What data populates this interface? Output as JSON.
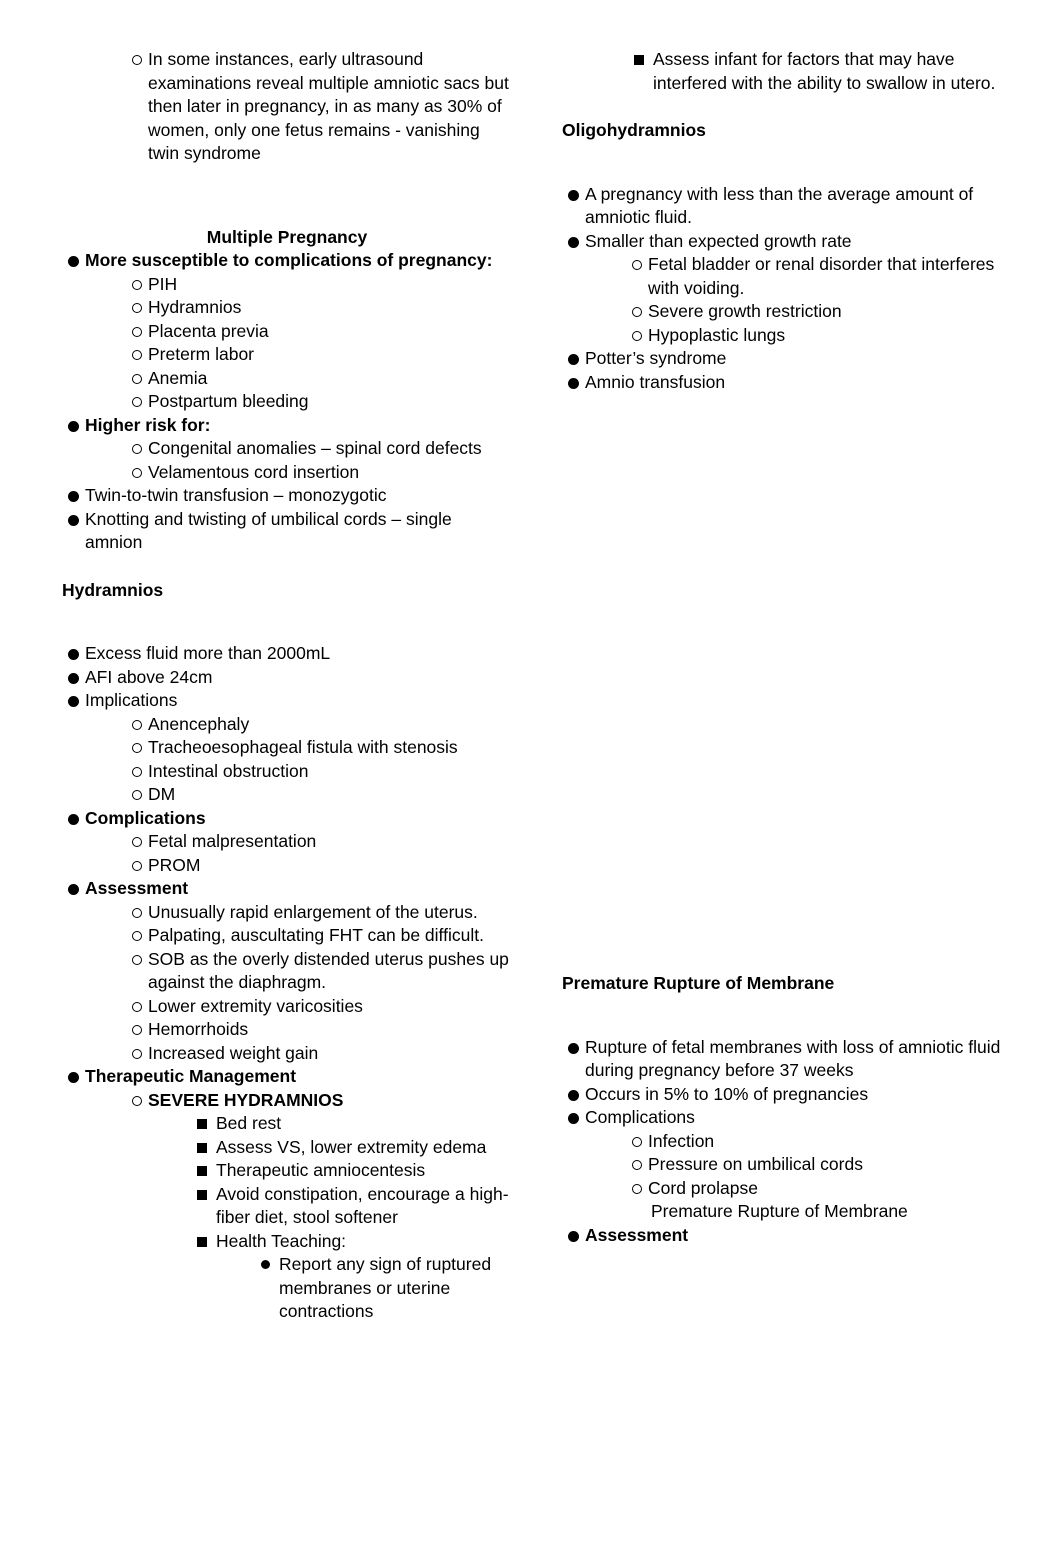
{
  "document": {
    "left_column": {
      "intro_item": "In some instances, early ultrasound examinations reveal multiple amniotic sacs but then later in pregnancy, in as many as 30% of women, only one fetus remains - vanishing twin syndrome",
      "section_multiple_pregnancy": {
        "title": "Multiple Pregnancy",
        "item_susceptible": "More susceptible to complications of pregnancy:",
        "susceptible_list": [
          "PIH",
          "Hydramnios",
          "Placenta previa",
          "Preterm labor",
          "Anemia",
          "Postpartum bleeding"
        ],
        "item_higher_risk": "Higher risk for:",
        "higher_risk_list": [
          "Congenital anomalies – spinal cord defects",
          "Velamentous cord insertion"
        ],
        "item_twin_transfusion": "Twin-to-twin transfusion – monozygotic",
        "item_knotting": "Knotting and twisting of umbilical cords – single amnion"
      },
      "section_hydramnios": {
        "title": "Hydramnios",
        "item_excess_fluid": "Excess fluid more than 2000mL",
        "item_afi": "AFI above 24cm",
        "item_implications": "Implications",
        "implications_list": [
          "Anencephaly",
          "Tracheoesophageal fistula with stenosis",
          "Intestinal obstruction",
          "DM"
        ],
        "item_complications": "Complications",
        "complications_list": [
          "Fetal malpresentation",
          "PROM"
        ],
        "item_assessment": "Assessment",
        "assessment_list": [
          "Unusually rapid enlargement of the uterus.",
          "Palpating, auscultating FHT can be difficult.",
          "SOB as the overly distended uterus pushes up against the diaphragm.",
          "Lower extremity varicosities",
          "Hemorrhoids",
          "Increased weight gain"
        ],
        "item_therapeutic": "Therapeutic Management",
        "severe_label": "SEVERE HYDRAMNIOS",
        "severe_list": [
          "Bed rest",
          "Assess VS, lower extremity edema",
          "Therapeutic amniocentesis",
          "Avoid constipation, encourage a high-fiber diet, stool softener",
          "Health Teaching:"
        ],
        "health_teaching_sub": "Report any sign of ruptured membranes or uterine contractions"
      }
    },
    "right_column": {
      "item_assess_infant": "Assess infant for factors that may have interfered with the ability to swallow in utero.",
      "section_oligohydramnios": {
        "title": "Oligohydramnios",
        "item_pregnancy_less": "A pregnancy with less than the average amount of amniotic fluid.",
        "item_smaller_growth": "Smaller than expected growth rate",
        "growth_list": [
          "Fetal bladder or renal disorder that interferes with voiding.",
          "Severe growth restriction",
          "Hypoplastic lungs"
        ],
        "item_potter": "Potter’s syndrome",
        "item_amnio": "Amnio transfusion"
      },
      "section_prom": {
        "title": "Premature Rupture of Membrane",
        "item_rupture": "Rupture of fetal membranes with loss of amniotic fluid during pregnancy before 37 weeks",
        "item_occurs": "Occurs in 5% to 10% of pregnancies",
        "item_complications": "Complications",
        "complications_list": [
          "Infection",
          "Pressure on umbilical cords",
          "Cord prolapse"
        ],
        "trailing_line": "Premature Rupture of Membrane",
        "item_assessment": "Assessment"
      }
    }
  }
}
